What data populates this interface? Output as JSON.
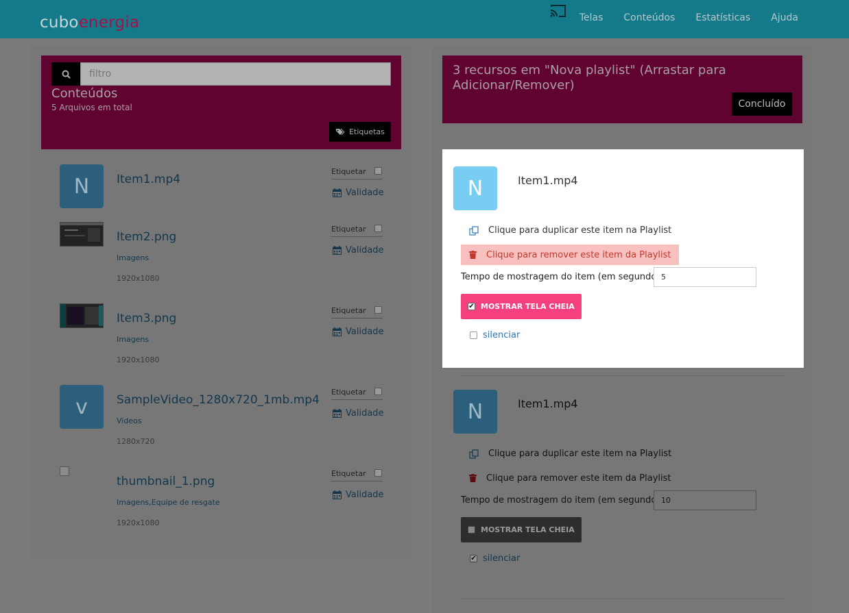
{
  "app": {
    "logo_a": "cubo",
    "logo_b": "energia"
  },
  "nav": {
    "items": [
      "Telas",
      "Conteúdos",
      "Estatísticas",
      "Ajuda"
    ]
  },
  "library": {
    "search_placeholder": "filtro",
    "title": "Conteúdos",
    "subtitle": "5 Arquivos em total",
    "tags_button": "Etiquetas",
    "items": [
      {
        "name": "Item1.mp4",
        "thumb_letter": "N",
        "type": "",
        "resolution": "",
        "tag_label": "Etiquetar",
        "validity_label": "Validade"
      },
      {
        "name": "Item2.png",
        "thumb_letter": "",
        "type": "Imagens",
        "resolution": "1920x1080",
        "tag_label": "Etiquetar",
        "validity_label": "Validade"
      },
      {
        "name": "Item3.png",
        "thumb_letter": "",
        "type": "Imagens",
        "resolution": "1920x1080",
        "tag_label": "Etiquetar",
        "validity_label": "Validade"
      },
      {
        "name": "SampleVideo_1280x720_1mb.mp4",
        "thumb_letter": "v",
        "type": "Videos",
        "resolution": "1280x720",
        "tag_label": "Etiquetar",
        "validity_label": "Validade"
      },
      {
        "name": "thumbnail_1.png",
        "thumb_letter": "",
        "type": "Imagens,Equipe de resgate",
        "resolution": "1920x1080",
        "tag_label": "Etiquetar",
        "validity_label": "Validade"
      }
    ]
  },
  "playlist": {
    "header": "3 recursos em  \"Nova playlist\"  (Arrastar para Adicionar/Remover)",
    "done_button": "Concluído",
    "items": [
      {
        "name": "Item1.mp4",
        "thumb_letter": "N",
        "duplicate_label": "Clique para duplicar este item na Playlist",
        "remove_label": "Clique para remover este item da Playlist",
        "time_label": "Tempo de mostragem do item (em segundos):",
        "time_value": "5",
        "fullscreen_label": "MOSTRAR TELA CHEIA",
        "fullscreen_checked": true,
        "mute_label": "silenciar",
        "mute_checked": false
      },
      {
        "name": "Item1.mp4",
        "thumb_letter": "N",
        "duplicate_label": "Clique para duplicar este item na Playlist",
        "remove_label": "Clique para remover este item da Playlist",
        "time_label": "Tempo de mostragem do item (em segundos):",
        "time_value": "10",
        "fullscreen_label": "MOSTRAR TELA CHEIA",
        "fullscreen_checked": false,
        "mute_label": "silenciar",
        "mute_checked": true
      }
    ]
  },
  "colors": {
    "nav": "#147a8a",
    "accent": "#a3124a",
    "highlight": "#f5407f",
    "remove_bg": "#f9c0c0",
    "thumb": "#77cdf2"
  }
}
